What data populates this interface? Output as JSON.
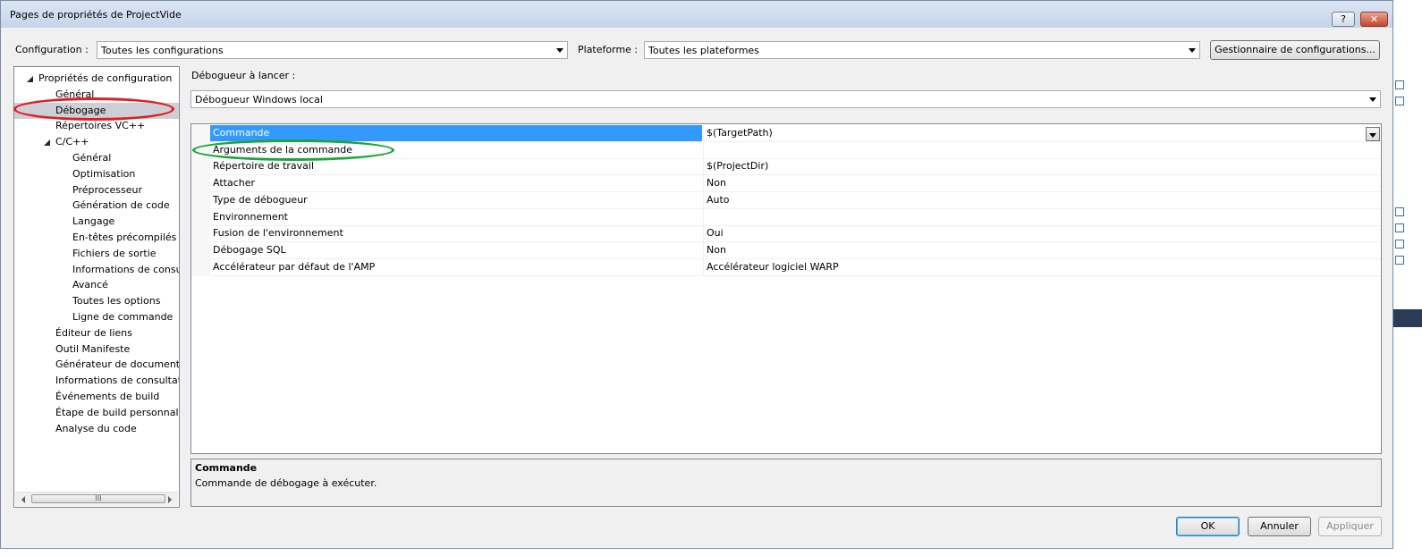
{
  "window": {
    "title": "Pages de propriétés de ProjectVide",
    "help_label": "?",
    "close_label": "✕"
  },
  "toolbar": {
    "configuration_label": "Configuration :",
    "configuration_value": "Toutes les configurations",
    "platform_label": "Plateforme :",
    "platform_value": "Toutes les plateformes",
    "config_manager_label": "Gestionnaire de configurations..."
  },
  "tree": {
    "items": [
      {
        "label": "Propriétés de configuration",
        "expand": "open"
      },
      {
        "label": "Général"
      },
      {
        "label": "Débogage",
        "selected": true
      },
      {
        "label": "Répertoires VC++"
      },
      {
        "label": "C/C++",
        "expand": "open"
      },
      {
        "label": "Général"
      },
      {
        "label": "Optimisation"
      },
      {
        "label": "Préprocesseur"
      },
      {
        "label": "Génération de code"
      },
      {
        "label": "Langage"
      },
      {
        "label": "En-têtes précompilés"
      },
      {
        "label": "Fichiers de sortie"
      },
      {
        "label": "Informations de consu"
      },
      {
        "label": "Avancé"
      },
      {
        "label": "Toutes les options"
      },
      {
        "label": "Ligne de commande"
      },
      {
        "label": "Éditeur de liens",
        "expand": "closed"
      },
      {
        "label": "Outil Manifeste",
        "expand": "closed"
      },
      {
        "label": "Générateur de document X",
        "expand": "closed"
      },
      {
        "label": "Informations de consultati",
        "expand": "closed"
      },
      {
        "label": "Événements de build",
        "expand": "closed"
      },
      {
        "label": "Étape de build personnalis",
        "expand": "closed"
      },
      {
        "label": "Analyse du code",
        "expand": "closed"
      }
    ],
    "scroll_grip": "III"
  },
  "debugger": {
    "label": "Débogueur à lancer :",
    "value": "Débogueur Windows local"
  },
  "properties": [
    {
      "name": "Commande",
      "value": "$(TargetPath)",
      "selected": true
    },
    {
      "name": "Arguments de la commande",
      "value": ""
    },
    {
      "name": "Répertoire de travail",
      "value": "$(ProjectDir)"
    },
    {
      "name": "Attacher",
      "value": "Non"
    },
    {
      "name": "Type de débogueur",
      "value": "Auto"
    },
    {
      "name": "Environnement",
      "value": ""
    },
    {
      "name": "Fusion de l'environnement",
      "value": "Oui"
    },
    {
      "name": "Débogage SQL",
      "value": "Non"
    },
    {
      "name": "Accélérateur par défaut de l'AMP",
      "value": "Accélérateur logiciel WARP"
    }
  ],
  "description": {
    "title": "Commande",
    "text": "Commande de débogage à exécuter."
  },
  "buttons": {
    "ok": "OK",
    "cancel": "Annuler",
    "apply": "Appliquer"
  },
  "annotations": {
    "red_ellipse_color": "#e21b22",
    "green_ellipse_color": "#1aa63a"
  }
}
